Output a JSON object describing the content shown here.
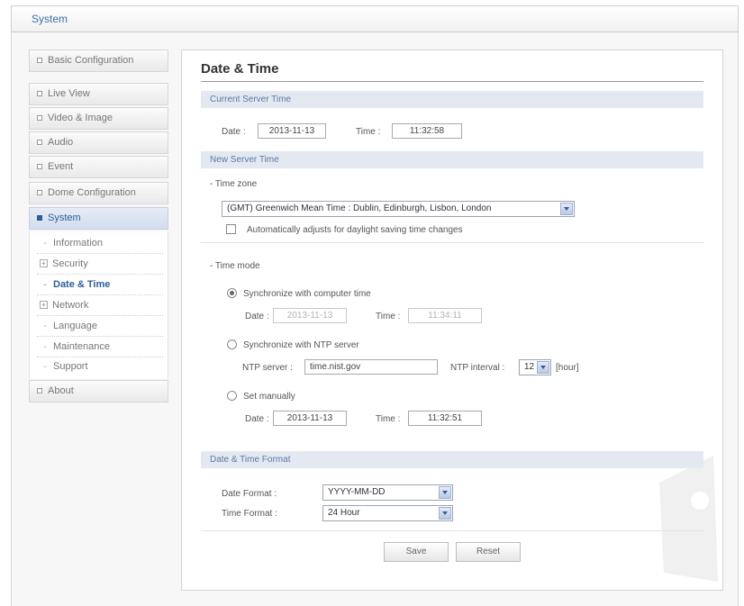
{
  "app": {
    "title": "System"
  },
  "sidebar": {
    "items": [
      {
        "label": "Basic Configuration"
      },
      {
        "label": "Live View"
      },
      {
        "label": "Video & Image"
      },
      {
        "label": "Audio"
      },
      {
        "label": "Event"
      },
      {
        "label": "Dome Configuration"
      },
      {
        "label": "System"
      },
      {
        "label": "About"
      }
    ],
    "system_sub": [
      {
        "label": "Information"
      },
      {
        "label": "Security"
      },
      {
        "label": "Date & Time"
      },
      {
        "label": "Network"
      },
      {
        "label": "Language"
      },
      {
        "label": "Maintenance"
      },
      {
        "label": "Support"
      }
    ],
    "active": "System",
    "current_sub": "Date & Time"
  },
  "main": {
    "title": "Date & Time",
    "current": {
      "header": "Current Server Time",
      "date_label": "Date :",
      "date_value": "2013-11-13",
      "time_label": "Time :",
      "time_value": "11:32:58"
    },
    "new_time": {
      "header": "New Server Time",
      "timezone_label": "- Time zone",
      "timezone_value": "(GMT) Greenwich Mean Time : Dublin, Edinburgh, Lisbon, London",
      "dst_label": "Automatically adjusts for daylight saving time changes",
      "dst_checked": false,
      "mode_label": "- Time mode",
      "sync_computer": {
        "label": "Synchronize with computer time",
        "selected": true,
        "date_label": "Date :",
        "date_value": "2013-11-13",
        "time_label": "Time :",
        "time_value": "11:34:11"
      },
      "sync_ntp": {
        "label": "Synchronize with NTP server",
        "selected": false,
        "server_label": "NTP server :",
        "server_value": "time.nist.gov",
        "interval_label": "NTP interval :",
        "interval_value": "12",
        "unit": "[hour]"
      },
      "manual": {
        "label": "Set manually",
        "selected": false,
        "date_label": "Date :",
        "date_value": "2013-11-13",
        "time_label": "Time :",
        "time_value": "11:32:51"
      }
    },
    "format": {
      "header": "Date & Time Format",
      "date_label": "Date Format :",
      "date_value": "YYYY-MM-DD",
      "time_label": "Time Format :",
      "time_value": "24 Hour"
    },
    "buttons": {
      "save": "Save",
      "reset": "Reset"
    }
  }
}
